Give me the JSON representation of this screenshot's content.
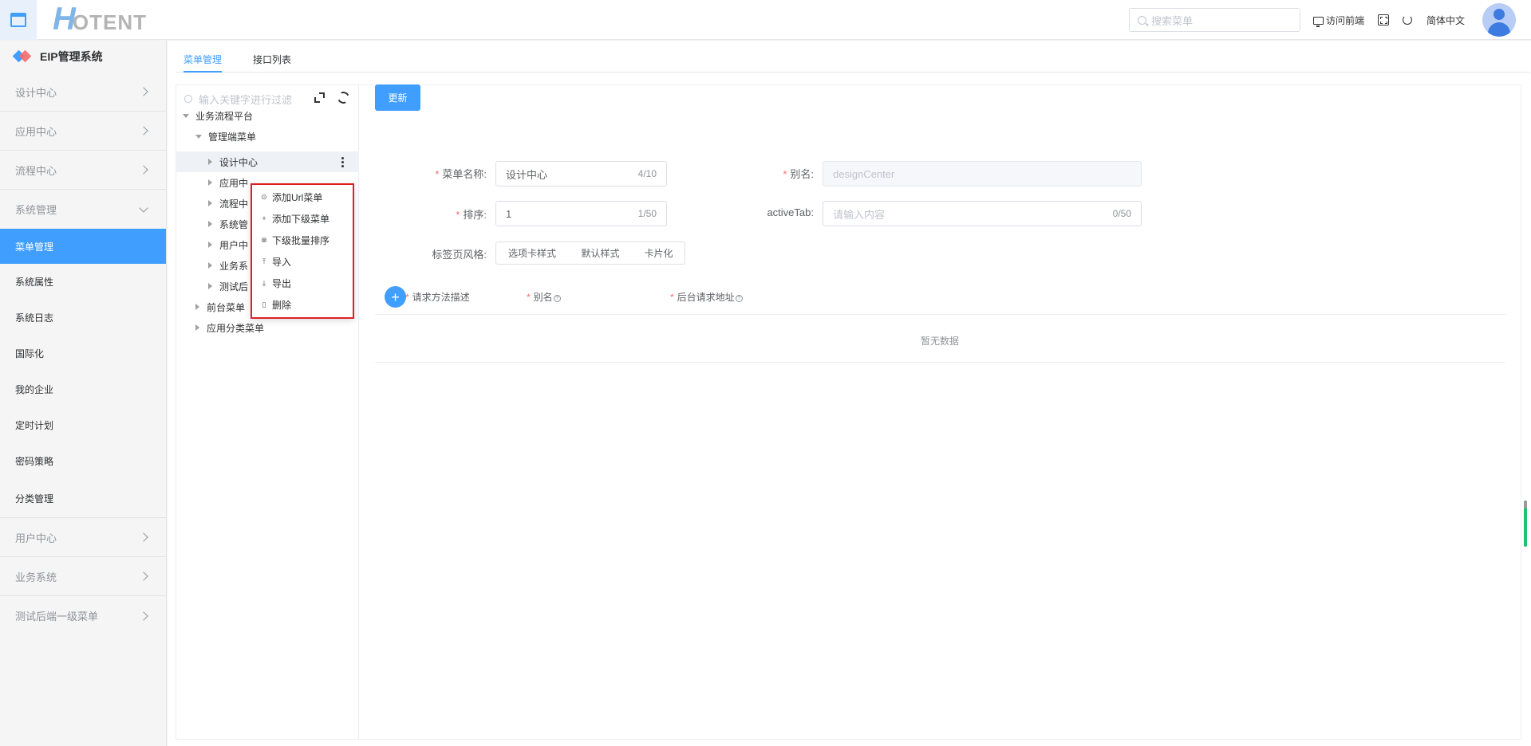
{
  "header": {
    "logo_h": "H",
    "logo_rest": "OTENT",
    "search_placeholder": "搜索菜单",
    "visit_front": "访问前端",
    "language": "简体中文"
  },
  "sidebar": {
    "system_title": "EIP管理系统",
    "groups_top": [
      {
        "label": "设计中心",
        "expanded": false
      },
      {
        "label": "应用中心",
        "expanded": false
      },
      {
        "label": "流程中心",
        "expanded": false
      },
      {
        "label": "系统管理",
        "expanded": true
      }
    ],
    "sub_items": [
      {
        "label": "菜单管理",
        "active": true
      },
      {
        "label": "系统属性"
      },
      {
        "label": "系统日志"
      },
      {
        "label": "国际化"
      },
      {
        "label": "我的企业"
      },
      {
        "label": "定时计划"
      },
      {
        "label": "密码策略"
      },
      {
        "label": "分类管理"
      }
    ],
    "groups_bottom": [
      {
        "label": "用户中心"
      },
      {
        "label": "业务系统"
      },
      {
        "label": "测试后端一级菜单"
      }
    ]
  },
  "tabs": [
    {
      "label": "菜单管理",
      "active": true
    },
    {
      "label": "接口列表",
      "active": false
    }
  ],
  "tree": {
    "search_placeholder": "输入关键字进行过滤",
    "nodes": [
      {
        "label": "业务流程平台",
        "level": 0,
        "open": true
      },
      {
        "label": "管理端菜单",
        "level": 1,
        "open": true
      },
      {
        "label": "设计中心",
        "level": 2,
        "open": false,
        "selected": true
      },
      {
        "label": "应用中",
        "level": 2,
        "open": false
      },
      {
        "label": "流程中",
        "level": 2,
        "open": false
      },
      {
        "label": "系统管",
        "level": 2,
        "open": false
      },
      {
        "label": "用户中",
        "level": 2,
        "open": false
      },
      {
        "label": "业务系",
        "level": 2,
        "open": false
      },
      {
        "label": "测试后",
        "level": 2,
        "open": false
      },
      {
        "label": "前台菜单",
        "level": 1,
        "open": false
      },
      {
        "label": "应用分类菜单",
        "level": 1,
        "open": false
      }
    ]
  },
  "context_menu": {
    "items": [
      {
        "label": "添加Url菜单",
        "icon": "circle-plus-icon"
      },
      {
        "label": "添加下级菜单",
        "icon": "plus-icon"
      },
      {
        "label": "下级批量排序",
        "icon": "sort-icon"
      },
      {
        "label": "导入",
        "icon": "upload-icon"
      },
      {
        "label": "导出",
        "icon": "download-icon"
      },
      {
        "label": "删除",
        "icon": "trash-icon"
      }
    ]
  },
  "form": {
    "update_button": "更新",
    "menu_name_label": "菜单名称:",
    "menu_name_value": "设计中心",
    "menu_name_count": "4/10",
    "alias_label": "别名:",
    "alias_value": "designCenter",
    "sort_label": "排序:",
    "sort_value": "1",
    "sort_count": "1/50",
    "active_tab_label": "activeTab:",
    "active_tab_placeholder": "请输入内容",
    "active_tab_count": "0/50",
    "tab_style_label": "标签页风格:",
    "tab_style_options": [
      "选项卡样式",
      "默认样式",
      "卡片化"
    ],
    "required_mark": "*"
  },
  "api_table": {
    "add_symbol": "+",
    "columns": [
      {
        "label": "请求方法描述",
        "required": true,
        "help": false
      },
      {
        "label": "别名",
        "required": true,
        "help": true
      },
      {
        "label": "后台请求地址",
        "required": true,
        "help": true
      }
    ],
    "help_symbol": "?",
    "empty_text": "暂无数据"
  },
  "colors": {
    "primary": "#409eff",
    "required": "#f56c6c",
    "highlight_border": "#e02020"
  }
}
